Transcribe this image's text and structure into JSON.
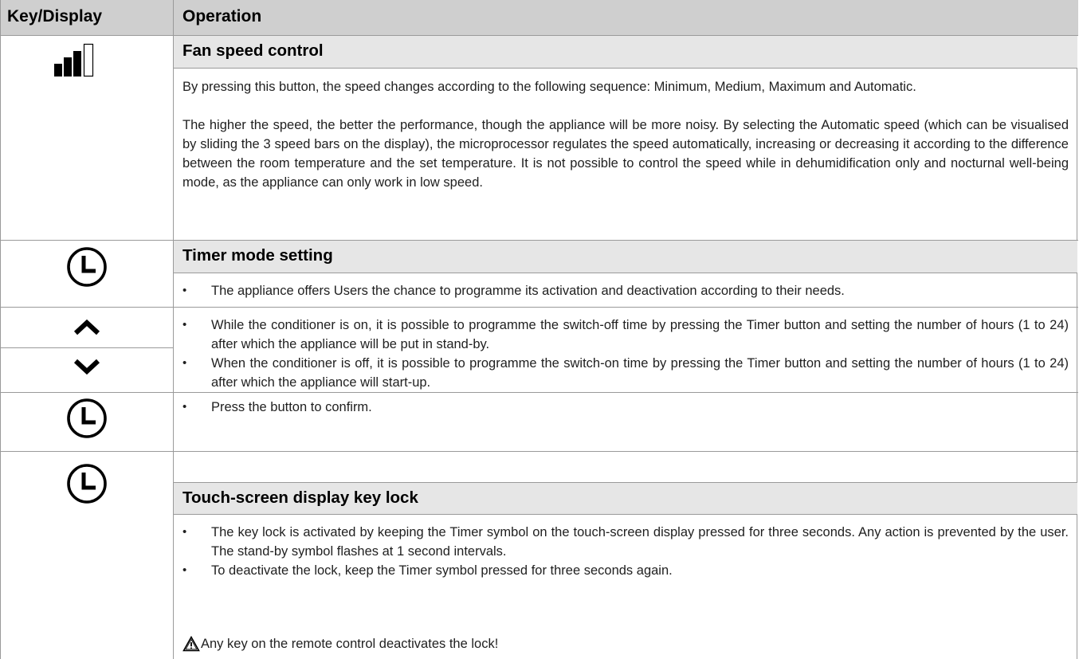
{
  "header": {
    "key_display": "Key/Display",
    "operation": "Operation"
  },
  "fan": {
    "title": "Fan speed control",
    "icon": "fan-speed-bars-icon",
    "p1": "By pressing this button, the speed changes according to the following sequence: Minimum, Medium, Maximum and Automatic.",
    "p2": "The higher the speed, the better the performance, though the appliance will be more noisy. By selecting the Automatic speed (which can be visualised by sliding the 3 speed bars on the display), the microprocessor regulates the speed automatically, increasing or decreasing it according to the difference between the room temperature and the set temperature.  It is not possible to control the speed while in dehumidification only and nocturnal well-being mode, as the appliance can only work in low speed."
  },
  "timer": {
    "title": "Timer mode setting",
    "icon": "clock-icon",
    "bullet": "The appliance offers Users the chance to programme its activation and deactivation according to their needs."
  },
  "arrows": {
    "up_icon": "chevron-up-icon",
    "down_icon": "chevron-down-icon",
    "bullet1": "While the conditioner is on, it is possible to programme the switch-off time by pressing the Timer button and setting the number of hours (1 to 24) after which the appliance will be put in stand-by.",
    "bullet2": "When the conditioner is off, it is possible to programme the switch-on time by pressing the Timer button and setting the number of hours (1 to 24) after which the appliance will start-up."
  },
  "confirm": {
    "icon": "clock-icon",
    "bullet": " Press the button to confirm."
  },
  "lock": {
    "title": "Touch-screen display key lock",
    "icon": "clock-icon",
    "bullet1": "The key lock is activated by keeping the Timer symbol on the touch-screen display pressed for three seconds. Any action is prevented by the user. The stand-by symbol flashes at 1 second intervals.",
    "bullet2": "To deactivate the lock, keep the Timer symbol pressed for three seconds again.",
    "warning_icon": "warning-triangle-icon",
    "warning": "Any key on the remote control deactivates the lock!"
  },
  "bullet_char": "•"
}
